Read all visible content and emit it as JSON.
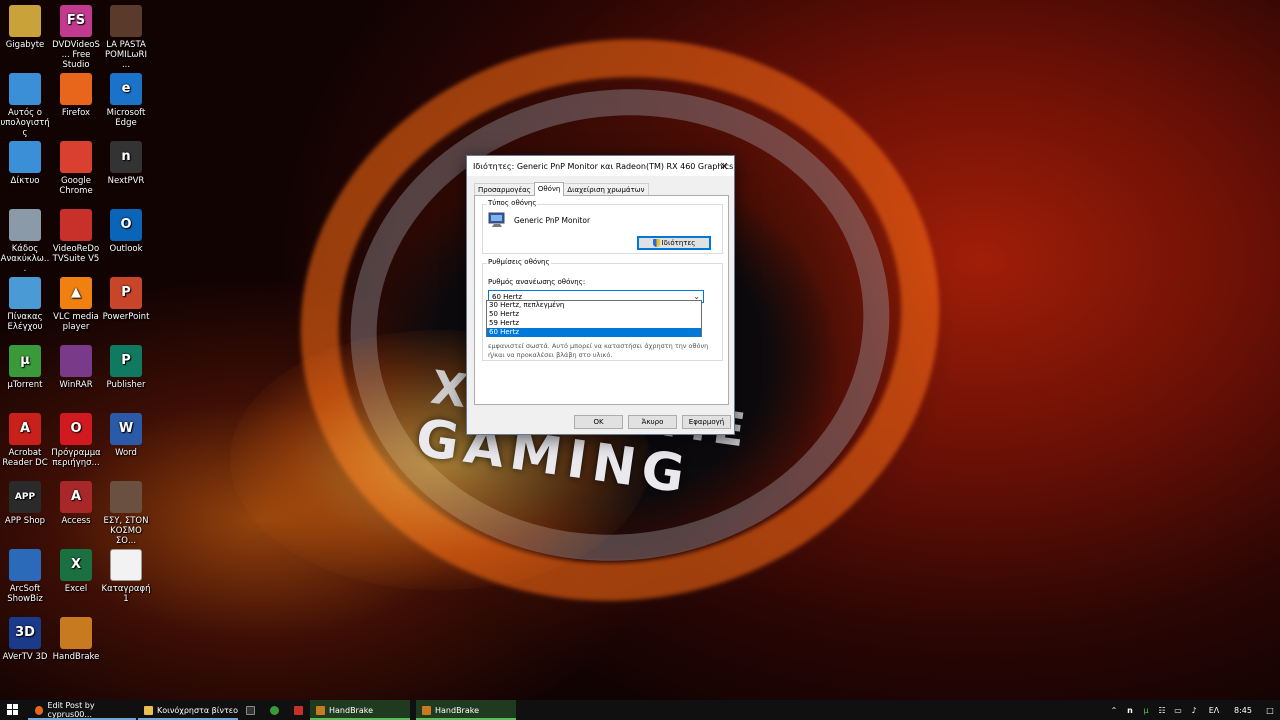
{
  "desktop": {
    "icons": [
      {
        "label": "Gigabyte",
        "icon": "gigabyte-icon",
        "color": "#c9a23a"
      },
      {
        "label": "DVDVideoS... Free Studio",
        "icon": "dvdvideosoft-icon",
        "color": "#c23a8f",
        "glyph": "FS"
      },
      {
        "label": "LA PASTA POMILωRI ...",
        "icon": "video-file-icon",
        "color": "#5a3a2a"
      },
      {
        "label": "Αυτός ο υπολογιστής",
        "icon": "this-pc-icon",
        "color": "#3a8fd6"
      },
      {
        "label": "Firefox",
        "icon": "firefox-icon",
        "color": "#e8661c"
      },
      {
        "label": "Microsoft Edge",
        "icon": "edge-icon",
        "color": "#1a73c8",
        "glyph": "e"
      },
      {
        "label": "Δίκτυο",
        "icon": "network-icon",
        "color": "#3a8fd6"
      },
      {
        "label": "Google Chrome",
        "icon": "chrome-icon",
        "color": "#d94030"
      },
      {
        "label": "NextPVR",
        "icon": "nextpvr-icon",
        "color": "#333333",
        "glyph": "n"
      },
      {
        "label": "Κάδος Ανακύκλω...",
        "icon": "recycle-bin-icon",
        "color": "#8a9aa8"
      },
      {
        "label": "VideoReDo TVSuite V5",
        "icon": "videoredo-icon",
        "color": "#c8302a"
      },
      {
        "label": "Outlook",
        "icon": "outlook-icon",
        "color": "#0a64b8",
        "glyph": "O"
      },
      {
        "label": "Πίνακας Ελέγχου",
        "icon": "control-panel-icon",
        "color": "#4a9ad6"
      },
      {
        "label": "VLC media player",
        "icon": "vlc-icon",
        "color": "#f08010",
        "glyph": "▲"
      },
      {
        "label": "PowerPoint",
        "icon": "powerpoint-icon",
        "color": "#c8452a",
        "glyph": "P"
      },
      {
        "label": "μTorrent",
        "icon": "utorrent-icon",
        "color": "#3a9a3a",
        "glyph": "μ"
      },
      {
        "label": "WinRAR",
        "icon": "winrar-icon",
        "color": "#7a3a8a"
      },
      {
        "label": "Publisher",
        "icon": "publisher-icon",
        "color": "#107a60",
        "glyph": "P"
      },
      {
        "label": "Acrobat Reader DC",
        "icon": "acrobat-icon",
        "color": "#c8201a",
        "glyph": "A"
      },
      {
        "label": "Πρόγραμμα περιήγησ...",
        "icon": "opera-icon",
        "color": "#d01a20",
        "glyph": "O"
      },
      {
        "label": "Word",
        "icon": "word-icon",
        "color": "#2a5aa8",
        "glyph": "W"
      },
      {
        "label": "APP Shop",
        "icon": "app-shop-icon",
        "color": "#2a2a2a",
        "glyph": "APP"
      },
      {
        "label": "Access",
        "icon": "access-icon",
        "color": "#a8282a",
        "glyph": "A"
      },
      {
        "label": "ΕΣΥ, ΣΤΟΝ ΚΟΣΜΟ ΣΟ...",
        "icon": "video-thumbnail-icon",
        "color": "#6a5040"
      },
      {
        "label": "ArcSoft ShowBiz",
        "icon": "arcsoft-icon",
        "color": "#2a6ab8"
      },
      {
        "label": "Excel",
        "icon": "excel-icon",
        "color": "#1a7040",
        "glyph": "X"
      },
      {
        "label": "Καταγραφή1",
        "icon": "document-icon",
        "color": "#f2f2f2"
      },
      {
        "label": "AVerTV 3D",
        "icon": "avertv-icon",
        "color": "#1a3a8a",
        "glyph": "3D"
      },
      {
        "label": "HandBrake",
        "icon": "handbrake-icon",
        "color": "#c87a20"
      }
    ]
  },
  "wallpaper": {
    "line1": "X",
    "line1b": "EME",
    "line2": "GAMING"
  },
  "dialog": {
    "title": "Ιδιότητες: Generic PnP Monitor και Radeon(TM) RX 460 Graphics",
    "close": "✕",
    "tabs": [
      "Προσαρμογέας",
      "Οθόνη",
      "Διαχείριση χρωμάτων"
    ],
    "monitor_type_group": "Τύπος οθόνης",
    "monitor_name": "Generic PnP Monitor",
    "properties_button": "Ιδιότητες",
    "monitor_settings_group": "Ρυθμίσεις οθόνης",
    "refresh_label": "Ρυθμός ανανέωσης οθόνης:",
    "refresh_value": "60 Hertz",
    "refresh_options": [
      "30 Hertz, πεπλεγμένη",
      "50 Hertz",
      "59 Hertz",
      "60 Hertz"
    ],
    "selected_option_index": 3,
    "warning_line1": "εμφανιστεί σωστά. Αυτό μπορεί να καταστήσει άχρηστη την οθόνη",
    "warning_line2": "ή/και να προκαλέσει βλάβη στο υλικό.",
    "ok_button": "OK",
    "cancel_button": "Άκυρο",
    "apply_button": "Εφαρμογή"
  },
  "taskbar": {
    "items": [
      {
        "label": "Edit Post by cyprus00...",
        "icon": "firefox-icon"
      },
      {
        "label": "Κοινόχρηστα βίντεο",
        "icon": "folder-icon"
      },
      {
        "label": "HandBrake",
        "icon": "handbrake-icon"
      },
      {
        "label": "HandBrake",
        "icon": "handbrake-icon"
      }
    ],
    "language": "ΕΛ",
    "time": "8:45",
    "accent": "#6fa8dc"
  }
}
